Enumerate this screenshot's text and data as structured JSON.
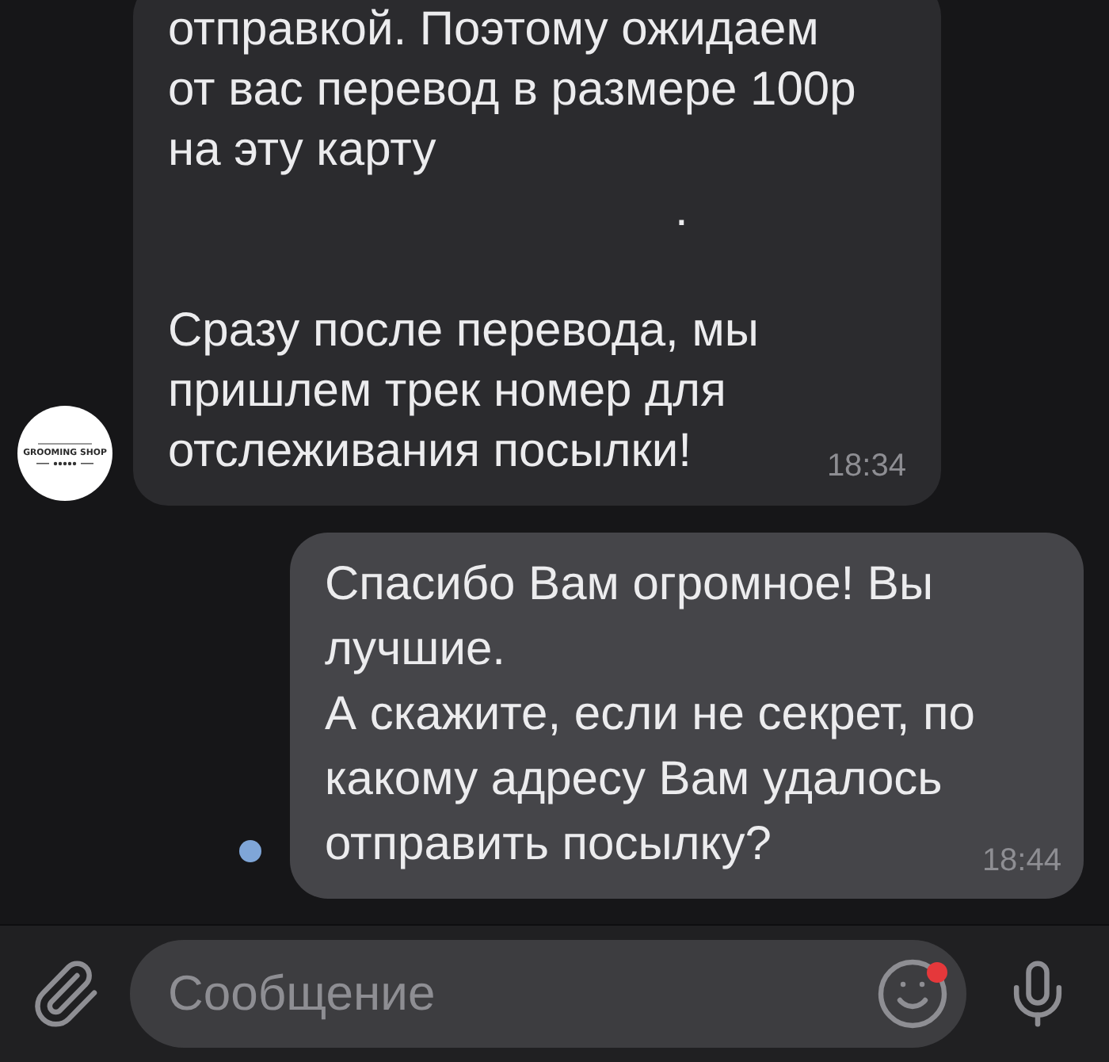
{
  "messages": [
    {
      "kind": "incoming",
      "avatar": {
        "logo_text": "GROOMING SHOP"
      },
      "paragraphs": [
        {
          "kind": "text",
          "text": "отправкой. Поэтому ожидаем от вас перевод в размере 100р на эту карту"
        },
        {
          "kind": "dot",
          "text": "."
        },
        {
          "kind": "text",
          "text": "Сразу после перевода, мы пришлем трек номер для отслеживания посылки!"
        }
      ],
      "time": "18:34"
    },
    {
      "kind": "outgoing",
      "paragraphs": [
        {
          "kind": "text",
          "text": "Спасибо Вам огромное! Вы лучшие."
        },
        {
          "kind": "text",
          "text": "А скажите, если не секрет, по какому адресу Вам удалось отправить посылку?"
        }
      ],
      "time": "18:44",
      "unread": true
    }
  ],
  "composer": {
    "placeholder": "Сообщение",
    "emoji_badge": true
  }
}
